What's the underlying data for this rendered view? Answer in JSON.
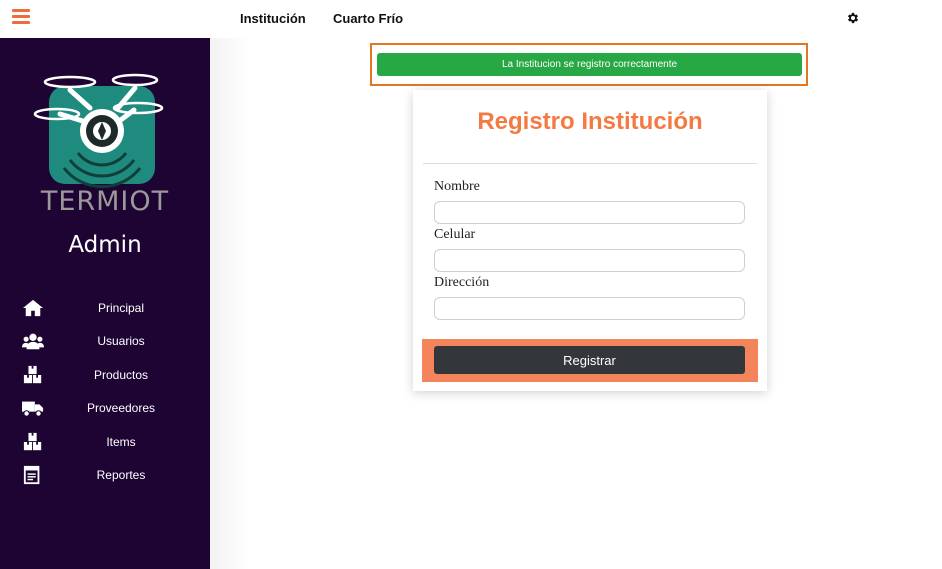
{
  "topbar": {
    "nav": [
      "Institución",
      "Cuarto Frío"
    ]
  },
  "sidebar": {
    "logo_text": "TERMIOT",
    "role": "Admin",
    "items": [
      {
        "label": "Principal",
        "icon": "home-icon"
      },
      {
        "label": "Usuarios",
        "icon": "users-icon"
      },
      {
        "label": "Productos",
        "icon": "boxes-icon"
      },
      {
        "label": "Proveedores",
        "icon": "truck-icon"
      },
      {
        "label": "Items",
        "icon": "boxes-icon"
      },
      {
        "label": "Reportes",
        "icon": "report-icon"
      }
    ]
  },
  "alert": {
    "message": "La Institucion se registro correctamente",
    "color": "#28a745"
  },
  "form": {
    "title": "Registro Institución",
    "fields": [
      {
        "label": "Nombre",
        "value": ""
      },
      {
        "label": "Celular",
        "value": ""
      },
      {
        "label": "Dirección",
        "value": ""
      }
    ],
    "submit_label": "Registrar"
  },
  "colors": {
    "accent": "#f47a42",
    "sidebar": "#1e0433",
    "logo_teal": "#1f8a7e",
    "button": "#33363b"
  }
}
